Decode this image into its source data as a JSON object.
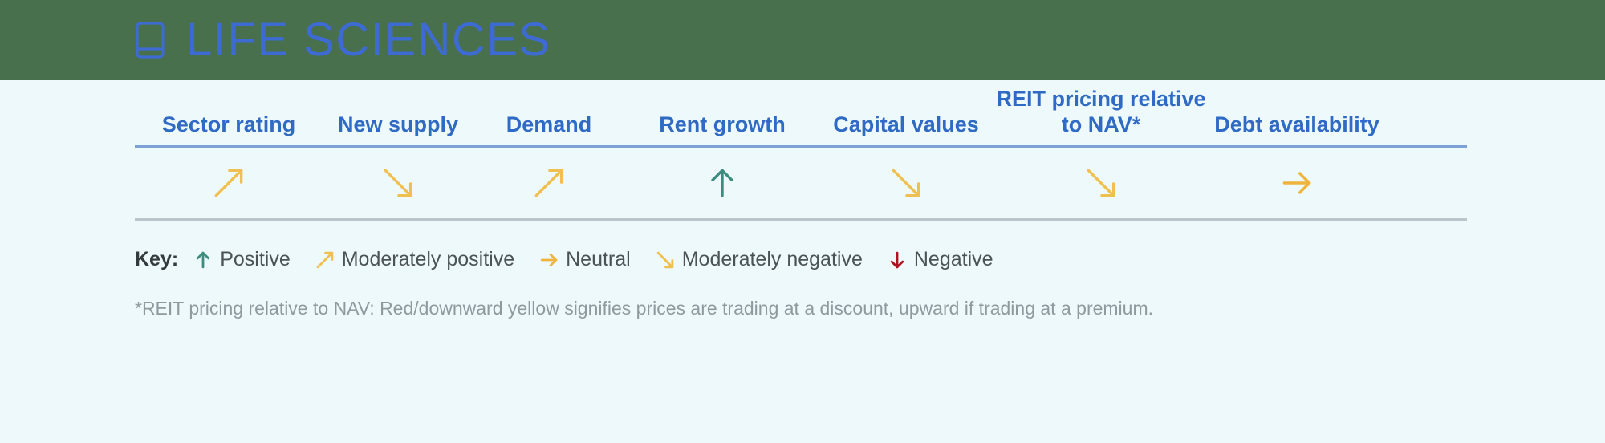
{
  "header": {
    "title": "LIFE SCIENCES",
    "icon": "book-icon",
    "background_color": "#48704C",
    "title_color": "#3D6BD1"
  },
  "colors": {
    "positive": "#3E8C7E",
    "moderately_positive": "#EFC050",
    "neutral": "#EFB43C",
    "moderately_negative": "#EFC050",
    "negative": "#B01020",
    "header_text": "#2F6AC4",
    "page_background": "#EEF9FB",
    "header_rule": "#7DA2D8",
    "body_rule": "#B9C5CA"
  },
  "matrix": {
    "columns": [
      {
        "header": "Sector rating",
        "rating": "moderately-positive",
        "arrow": "arrow-up-right-icon",
        "color": "#EFC050"
      },
      {
        "header": "New supply",
        "rating": "moderately-negative",
        "arrow": "arrow-down-right-icon",
        "color": "#EFC050"
      },
      {
        "header": "Demand",
        "rating": "moderately-positive",
        "arrow": "arrow-up-right-icon",
        "color": "#EFC050"
      },
      {
        "header": "Rent growth",
        "rating": "positive",
        "arrow": "arrow-up-icon",
        "color": "#3E8C7E"
      },
      {
        "header": "Capital values",
        "rating": "moderately-negative",
        "arrow": "arrow-down-right-icon",
        "color": "#EFC050"
      },
      {
        "header": "REIT pricing relative to NAV*",
        "rating": "moderately-negative",
        "arrow": "arrow-down-right-icon",
        "color": "#EFC050"
      },
      {
        "header": "Debt availability",
        "rating": "neutral",
        "arrow": "arrow-right-icon",
        "color": "#EFB43C"
      }
    ]
  },
  "key": {
    "label": "Key:",
    "items": [
      {
        "text": "Positive",
        "arrow": "arrow-up-icon",
        "color": "#3E8C7E"
      },
      {
        "text": "Moderately positive",
        "arrow": "arrow-up-right-icon",
        "color": "#EFC050"
      },
      {
        "text": "Neutral",
        "arrow": "arrow-right-icon",
        "color": "#EFB43C"
      },
      {
        "text": "Moderately negative",
        "arrow": "arrow-down-right-icon",
        "color": "#EFC050"
      },
      {
        "text": "Negative",
        "arrow": "arrow-down-icon",
        "color": "#B01020"
      }
    ]
  },
  "footnote": "*REIT pricing relative to NAV: Red/downward yellow signifies prices are trading at a discount, upward if trading at a premium."
}
